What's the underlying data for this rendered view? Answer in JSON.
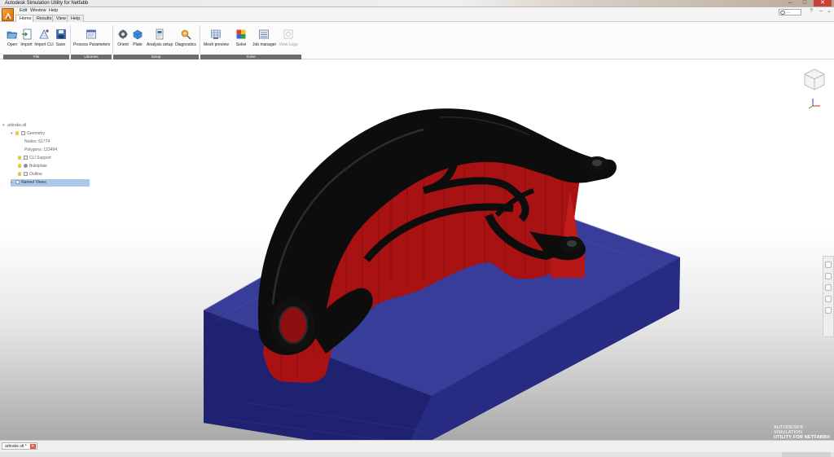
{
  "window": {
    "title": "Autodesk Simulation Utility for Netfabb",
    "minimize": "–",
    "maximize": "□",
    "close": "✕"
  },
  "menu": {
    "items": [
      "Edit",
      "Window",
      "Help"
    ]
  },
  "tabs": [
    {
      "label": "Home",
      "active": true
    },
    {
      "label": "Results",
      "active": false
    },
    {
      "label": "View",
      "active": false
    },
    {
      "label": "Help",
      "active": false
    }
  ],
  "user": {
    "label": "..."
  },
  "ribbon": {
    "file": {
      "group": "File",
      "buttons": [
        {
          "label": "Open",
          "icon": "folder-open-icon"
        },
        {
          "label": "Import",
          "icon": "import-icon"
        },
        {
          "label": "Import CLI",
          "icon": "import-cli-icon"
        },
        {
          "label": "Save",
          "icon": "floppy-disk-icon"
        }
      ]
    },
    "libraries": {
      "group": "Libraries",
      "buttons": [
        {
          "label": "Process Parameters",
          "icon": "process-parameters-icon"
        }
      ]
    },
    "setup": {
      "group": "Setup",
      "buttons": [
        {
          "label": "Orient",
          "icon": "orient-icon"
        },
        {
          "label": "Plate",
          "icon": "plate-icon"
        },
        {
          "label": "Analysis setup",
          "icon": "analysis-setup-icon"
        },
        {
          "label": "Diagnostics",
          "icon": "diagnostics-icon"
        }
      ]
    },
    "solve": {
      "group": "Solve",
      "buttons": [
        {
          "label": "Mesh preview",
          "icon": "mesh-preview-icon"
        },
        {
          "label": "Solve",
          "icon": "solve-icon"
        },
        {
          "label": "Job manager",
          "icon": "job-manager-icon"
        },
        {
          "label": "View Logs",
          "icon": "view-logs-icon",
          "disabled": true
        }
      ]
    }
  },
  "tree": {
    "root": "arbrake.stl",
    "geometry": "Geometry",
    "nodes": "Nodes: 61774",
    "polygons": "Polygons: 123494",
    "cli_support": "CLI Support",
    "buildplate": "Buildplate",
    "outline": "Outline",
    "named_views": "Named Views"
  },
  "brand": {
    "line1": "AUTODESK® SIMULATION",
    "line2": "UTILITY FOR NETFABB®"
  },
  "document_tab": {
    "label": "arbrake.stl *",
    "close": "✕"
  },
  "colors": {
    "part": "#0d0d0d",
    "support": "#b01818",
    "buildplate": "#2a2f8a",
    "ribbon_group_bar": "#6c6c6c",
    "selection": "#aac8ec"
  }
}
